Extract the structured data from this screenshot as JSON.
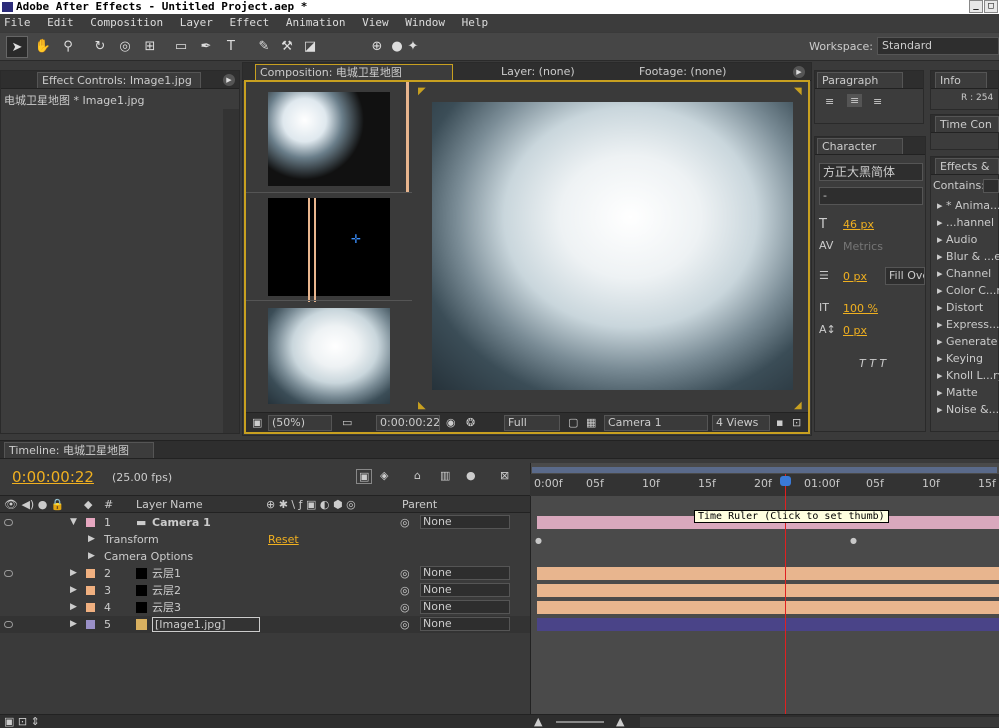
{
  "app": {
    "title": "Adobe After Effects - Untitled Project.aep *"
  },
  "menu": [
    "File",
    "Edit",
    "Composition",
    "Layer",
    "Effect",
    "Animation",
    "View",
    "Window",
    "Help"
  ],
  "toolbar": {
    "workspace_label": "Workspace:",
    "workspace_value": "Standard"
  },
  "effect_controls": {
    "tab": "Effect Controls: Image1.jpg",
    "breadcrumb": "电城卫星地图 * Image1.jpg"
  },
  "composition": {
    "tab": "Composition: 电城卫星地图",
    "layer_tab": "Layer: (none)",
    "footage_tab": "Footage: (none)",
    "zoom": "(50%)",
    "timecode": "0:00:00:22",
    "resolution": "Full",
    "camera": "Camera 1",
    "views": "4 Views"
  },
  "paragraph": {
    "tab": "Paragraph"
  },
  "character": {
    "tab": "Character",
    "font": "方正大黑简体",
    "style": "-",
    "size": "46 px",
    "kerning": "Metrics",
    "stroke": "0 px",
    "fill": "Fill Ove",
    "vscale": "100 %",
    "baseline": "0 px"
  },
  "info": {
    "tab": "Info",
    "value": "R : 254"
  },
  "time_controls": {
    "tab": "Time Con"
  },
  "effects_presets": {
    "tab": "Effects &",
    "contains": "Contains:",
    "items": [
      "* Anima...s",
      "...hannel",
      "Audio",
      "Blur & ...en",
      "Channel",
      "Color C...n",
      "Distort",
      "Express...ls",
      "Generate",
      "Keying",
      "Knoll L...ry",
      "Matte",
      "Noise &...n"
    ]
  },
  "timeline": {
    "tab": "Timeline: 电城卫星地图",
    "timecode": "0:00:00:22",
    "fps": "(25.00 fps)",
    "headers": {
      "num": "#",
      "layer_name": "Layer Name",
      "parent": "Parent"
    },
    "ruler": [
      "0:00f",
      "05f",
      "10f",
      "15f",
      "20f",
      "01:00f",
      "05f",
      "10f",
      "15f"
    ],
    "tooltip": "Time Ruler (Click to set thumb)",
    "layers": [
      {
        "num": "1",
        "name": "Camera 1",
        "parent": "None",
        "color": "#e6a7c0",
        "bar": "#d9a8bd"
      },
      {
        "num": "2",
        "name": "云层1",
        "parent": "None",
        "color": "#f0b080",
        "bar": "#e8b58e"
      },
      {
        "num": "3",
        "name": "云层2",
        "parent": "None",
        "color": "#f0b080",
        "bar": "#e8b58e"
      },
      {
        "num": "4",
        "name": "云层3",
        "parent": "None",
        "color": "#f0b080",
        "bar": "#e8b58e"
      },
      {
        "num": "5",
        "name": "[Image1.jpg]",
        "parent": "None",
        "color": "#9a90c8",
        "bar": "#4a4488"
      }
    ],
    "sub": {
      "transform": "Transform",
      "reset": "Reset",
      "camera_options": "Camera Options"
    }
  }
}
